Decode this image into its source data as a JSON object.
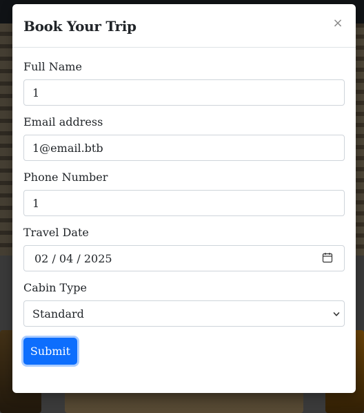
{
  "modal": {
    "title": "Book Your Trip",
    "close_symbol": "×",
    "close_icon": "close-icon"
  },
  "form": {
    "full_name": {
      "label": "Full Name",
      "value": "1"
    },
    "email": {
      "label": "Email address",
      "value": "1@email.btb"
    },
    "phone": {
      "label": "Phone Number",
      "value": "1"
    },
    "travel_date": {
      "label": "Travel Date",
      "value": "02 / 04 / 2025",
      "icon": "calendar-icon"
    },
    "cabin_type": {
      "label": "Cabin Type",
      "selected": "Standard",
      "icon": "chevron-down-icon"
    },
    "submit_label": "Submit"
  },
  "colors": {
    "primary": "#0d6efd",
    "border": "#ced4da",
    "text": "#212529",
    "backdrop": "rgba(0,0,0,0.45)"
  }
}
